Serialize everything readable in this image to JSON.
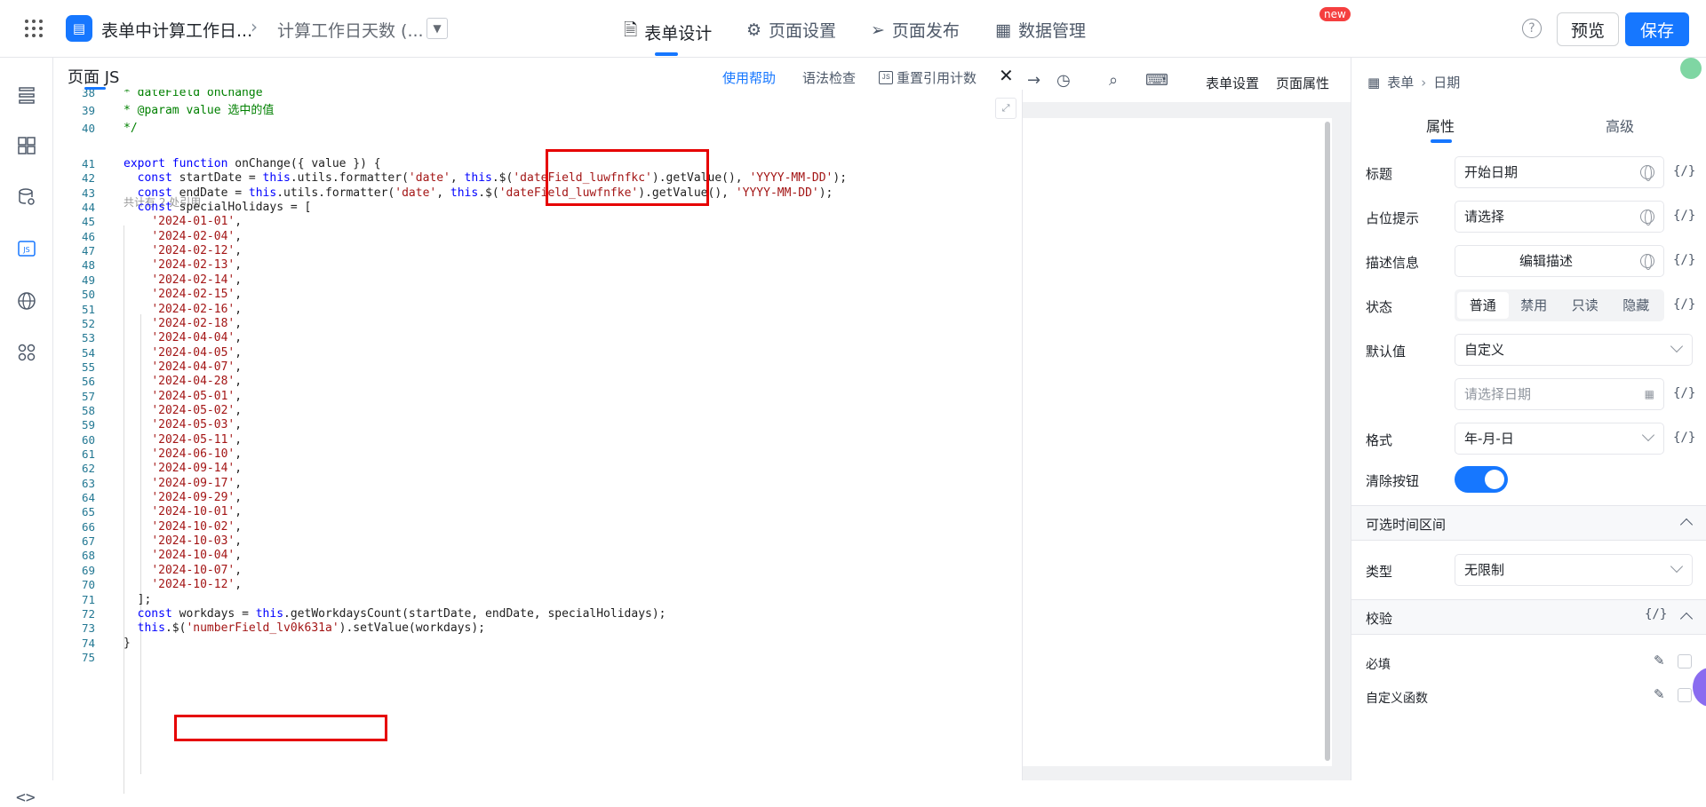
{
  "app": {
    "name": "表单中计算工作日...",
    "page_name": "计算工作日天数 (..."
  },
  "nav": {
    "tabs": [
      {
        "label": "表单设计",
        "icon": "document-icon"
      },
      {
        "label": "页面设置",
        "icon": "gear-icon"
      },
      {
        "label": "页面发布",
        "icon": "send-icon"
      },
      {
        "label": "数据管理",
        "icon": "table-icon"
      }
    ]
  },
  "actions": {
    "preview": "预览",
    "save": "保存",
    "help": "?"
  },
  "code_panel": {
    "title": "页面 JS",
    "help": "使用帮助",
    "lint": "语法检查",
    "reset": "重置引用计数",
    "ref_hint": "共计有 2 处引用",
    "lines": [
      {
        "n": "38",
        "t": "* dateField onChange"
      },
      {
        "n": "39",
        "t": "* @param value 选中的值"
      },
      {
        "n": "40",
        "t": "*/"
      },
      {
        "n": "41",
        "t": "export function onChange({ value }) {"
      },
      {
        "n": "42",
        "t": "  const startDate = this.utils.formatter('date', this.$('dateField_luwfnfkc').getValue(), 'YYYY-MM-DD');"
      },
      {
        "n": "43",
        "t": "  const endDate = this.utils.formatter('date', this.$('dateField_luwfnfke').getValue(), 'YYYY-MM-DD');"
      },
      {
        "n": "44",
        "t": "  const specialHolidays = ["
      },
      {
        "n": "45",
        "t": "    '2024-01-01',"
      },
      {
        "n": "46",
        "t": "    '2024-02-04',"
      },
      {
        "n": "47",
        "t": "    '2024-02-12',"
      },
      {
        "n": "48",
        "t": "    '2024-02-13',"
      },
      {
        "n": "49",
        "t": "    '2024-02-14',"
      },
      {
        "n": "50",
        "t": "    '2024-02-15',"
      },
      {
        "n": "51",
        "t": "    '2024-02-16',"
      },
      {
        "n": "52",
        "t": "    '2024-02-18',"
      },
      {
        "n": "53",
        "t": "    '2024-04-04',"
      },
      {
        "n": "54",
        "t": "    '2024-04-05',"
      },
      {
        "n": "55",
        "t": "    '2024-04-07',"
      },
      {
        "n": "56",
        "t": "    '2024-04-28',"
      },
      {
        "n": "57",
        "t": "    '2024-05-01',"
      },
      {
        "n": "58",
        "t": "    '2024-05-02',"
      },
      {
        "n": "59",
        "t": "    '2024-05-03',"
      },
      {
        "n": "60",
        "t": "    '2024-05-11',"
      },
      {
        "n": "61",
        "t": "    '2024-06-10',"
      },
      {
        "n": "62",
        "t": "    '2024-09-14',"
      },
      {
        "n": "63",
        "t": "    '2024-09-17',"
      },
      {
        "n": "64",
        "t": "    '2024-09-29',"
      },
      {
        "n": "65",
        "t": "    '2024-10-01',"
      },
      {
        "n": "66",
        "t": "    '2024-10-02',"
      },
      {
        "n": "67",
        "t": "    '2024-10-03',"
      },
      {
        "n": "68",
        "t": "    '2024-10-04',"
      },
      {
        "n": "69",
        "t": "    '2024-10-07',"
      },
      {
        "n": "70",
        "t": "    '2024-10-12',"
      },
      {
        "n": "71",
        "t": "  ];"
      },
      {
        "n": "72",
        "t": "  const workdays = this.getWorkdaysCount(startDate, endDate, specialHolidays);"
      },
      {
        "n": "73",
        "t": "  this.$('numberField_lv0k631a').setValue(workdays);"
      },
      {
        "n": "74",
        "t": "}"
      },
      {
        "n": "75",
        "t": ""
      }
    ]
  },
  "canvas_toolbar": {
    "form_settings": "表单设置",
    "page_props": "页面属性",
    "new_badge": "new"
  },
  "right_panel": {
    "breadcrumb": {
      "root": "表单",
      "leaf": "日期"
    },
    "tabs": [
      "属性",
      "高级"
    ],
    "rows": {
      "title_label": "标题",
      "title_value": "开始日期",
      "placeholder_label": "占位提示",
      "placeholder_value": "请选择",
      "desc_label": "描述信息",
      "desc_button": "编辑描述",
      "state_label": "状态",
      "state_options": [
        "普通",
        "禁用",
        "只读",
        "隐藏"
      ],
      "default_label": "默认值",
      "default_value": "自定义",
      "date_placeholder": "请选择日期",
      "format_label": "格式",
      "format_value": "年-月-日",
      "clear_label": "清除按钮",
      "range_section": "可选时间区间",
      "type_label": "类型",
      "type_value": "无限制",
      "validate_section": "校验",
      "required_label": "必填",
      "custom_fn_label": "自定义函数",
      "fx": "{/}"
    }
  }
}
